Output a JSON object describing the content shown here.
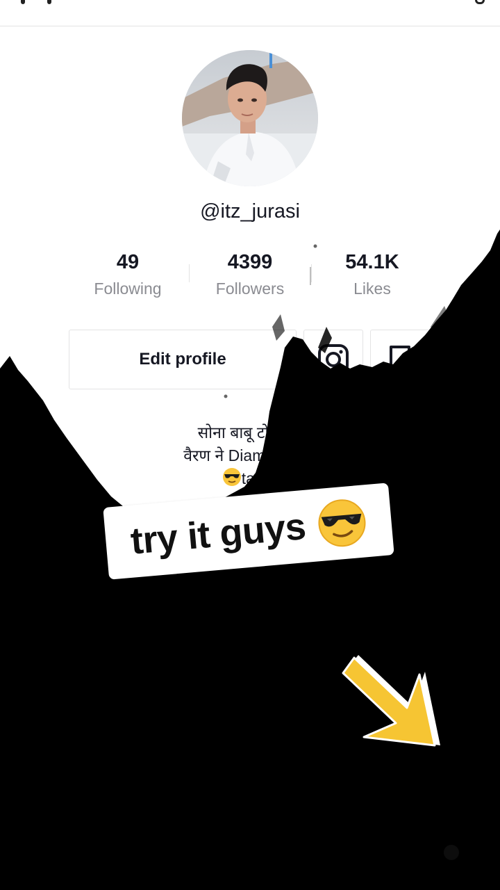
{
  "profile": {
    "username": "@itz_jurasi",
    "bio_line1": "सोना बाबू टोहण वे",
    "bio_line2": "वैरण ने Diamond यार",
    "bio_line3": "targe"
  },
  "stats": {
    "following": {
      "value": "49",
      "label": "Following"
    },
    "followers": {
      "value": "4399",
      "label": "Followers"
    },
    "likes": {
      "value": "54.1K",
      "label": "Likes"
    }
  },
  "actions": {
    "edit_profile_label": "Edit profile",
    "instagram_icon": "instagram-icon",
    "bookmark_icon": "bookmark-icon"
  },
  "overlay": {
    "sticker_text": "try it guys",
    "sticker_emoji": "sunglasses-emoji",
    "arrow_icon": "arrow-down-right-icon"
  },
  "colors": {
    "text_primary": "#161823",
    "text_secondary": "#8a8b91",
    "ink": "#000000",
    "arrow_yellow": "#f6c533"
  }
}
